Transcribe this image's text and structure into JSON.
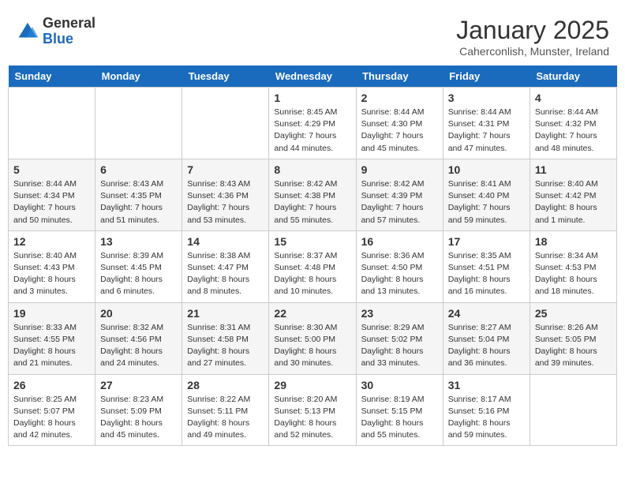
{
  "logo": {
    "general": "General",
    "blue": "Blue"
  },
  "title": "January 2025",
  "location": "Caherconlish, Munster, Ireland",
  "days_of_week": [
    "Sunday",
    "Monday",
    "Tuesday",
    "Wednesday",
    "Thursday",
    "Friday",
    "Saturday"
  ],
  "weeks": [
    [
      {
        "day": "",
        "info": ""
      },
      {
        "day": "",
        "info": ""
      },
      {
        "day": "",
        "info": ""
      },
      {
        "day": "1",
        "info": "Sunrise: 8:45 AM\nSunset: 4:29 PM\nDaylight: 7 hours and 44 minutes."
      },
      {
        "day": "2",
        "info": "Sunrise: 8:44 AM\nSunset: 4:30 PM\nDaylight: 7 hours and 45 minutes."
      },
      {
        "day": "3",
        "info": "Sunrise: 8:44 AM\nSunset: 4:31 PM\nDaylight: 7 hours and 47 minutes."
      },
      {
        "day": "4",
        "info": "Sunrise: 8:44 AM\nSunset: 4:32 PM\nDaylight: 7 hours and 48 minutes."
      }
    ],
    [
      {
        "day": "5",
        "info": "Sunrise: 8:44 AM\nSunset: 4:34 PM\nDaylight: 7 hours and 50 minutes."
      },
      {
        "day": "6",
        "info": "Sunrise: 8:43 AM\nSunset: 4:35 PM\nDaylight: 7 hours and 51 minutes."
      },
      {
        "day": "7",
        "info": "Sunrise: 8:43 AM\nSunset: 4:36 PM\nDaylight: 7 hours and 53 minutes."
      },
      {
        "day": "8",
        "info": "Sunrise: 8:42 AM\nSunset: 4:38 PM\nDaylight: 7 hours and 55 minutes."
      },
      {
        "day": "9",
        "info": "Sunrise: 8:42 AM\nSunset: 4:39 PM\nDaylight: 7 hours and 57 minutes."
      },
      {
        "day": "10",
        "info": "Sunrise: 8:41 AM\nSunset: 4:40 PM\nDaylight: 7 hours and 59 minutes."
      },
      {
        "day": "11",
        "info": "Sunrise: 8:40 AM\nSunset: 4:42 PM\nDaylight: 8 hours and 1 minute."
      }
    ],
    [
      {
        "day": "12",
        "info": "Sunrise: 8:40 AM\nSunset: 4:43 PM\nDaylight: 8 hours and 3 minutes."
      },
      {
        "day": "13",
        "info": "Sunrise: 8:39 AM\nSunset: 4:45 PM\nDaylight: 8 hours and 6 minutes."
      },
      {
        "day": "14",
        "info": "Sunrise: 8:38 AM\nSunset: 4:47 PM\nDaylight: 8 hours and 8 minutes."
      },
      {
        "day": "15",
        "info": "Sunrise: 8:37 AM\nSunset: 4:48 PM\nDaylight: 8 hours and 10 minutes."
      },
      {
        "day": "16",
        "info": "Sunrise: 8:36 AM\nSunset: 4:50 PM\nDaylight: 8 hours and 13 minutes."
      },
      {
        "day": "17",
        "info": "Sunrise: 8:35 AM\nSunset: 4:51 PM\nDaylight: 8 hours and 16 minutes."
      },
      {
        "day": "18",
        "info": "Sunrise: 8:34 AM\nSunset: 4:53 PM\nDaylight: 8 hours and 18 minutes."
      }
    ],
    [
      {
        "day": "19",
        "info": "Sunrise: 8:33 AM\nSunset: 4:55 PM\nDaylight: 8 hours and 21 minutes."
      },
      {
        "day": "20",
        "info": "Sunrise: 8:32 AM\nSunset: 4:56 PM\nDaylight: 8 hours and 24 minutes."
      },
      {
        "day": "21",
        "info": "Sunrise: 8:31 AM\nSunset: 4:58 PM\nDaylight: 8 hours and 27 minutes."
      },
      {
        "day": "22",
        "info": "Sunrise: 8:30 AM\nSunset: 5:00 PM\nDaylight: 8 hours and 30 minutes."
      },
      {
        "day": "23",
        "info": "Sunrise: 8:29 AM\nSunset: 5:02 PM\nDaylight: 8 hours and 33 minutes."
      },
      {
        "day": "24",
        "info": "Sunrise: 8:27 AM\nSunset: 5:04 PM\nDaylight: 8 hours and 36 minutes."
      },
      {
        "day": "25",
        "info": "Sunrise: 8:26 AM\nSunset: 5:05 PM\nDaylight: 8 hours and 39 minutes."
      }
    ],
    [
      {
        "day": "26",
        "info": "Sunrise: 8:25 AM\nSunset: 5:07 PM\nDaylight: 8 hours and 42 minutes."
      },
      {
        "day": "27",
        "info": "Sunrise: 8:23 AM\nSunset: 5:09 PM\nDaylight: 8 hours and 45 minutes."
      },
      {
        "day": "28",
        "info": "Sunrise: 8:22 AM\nSunset: 5:11 PM\nDaylight: 8 hours and 49 minutes."
      },
      {
        "day": "29",
        "info": "Sunrise: 8:20 AM\nSunset: 5:13 PM\nDaylight: 8 hours and 52 minutes."
      },
      {
        "day": "30",
        "info": "Sunrise: 8:19 AM\nSunset: 5:15 PM\nDaylight: 8 hours and 55 minutes."
      },
      {
        "day": "31",
        "info": "Sunrise: 8:17 AM\nSunset: 5:16 PM\nDaylight: 8 hours and 59 minutes."
      },
      {
        "day": "",
        "info": ""
      }
    ]
  ]
}
